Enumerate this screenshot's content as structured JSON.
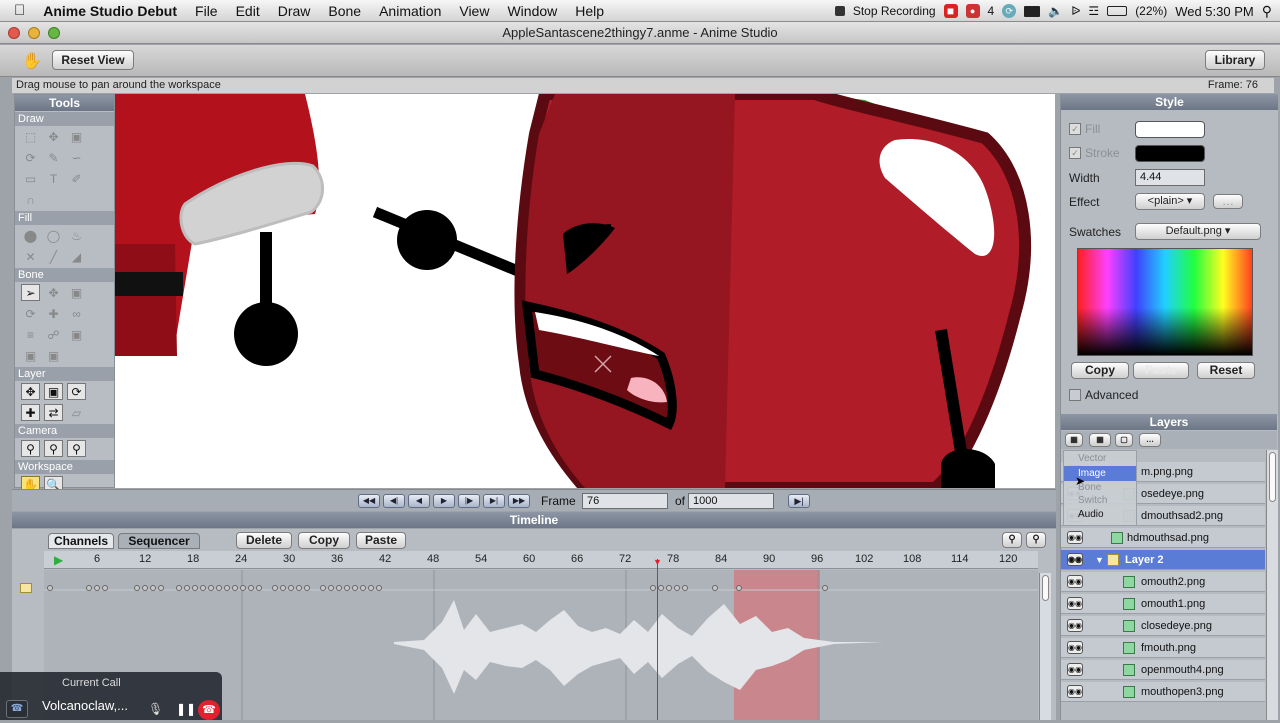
{
  "menubar": {
    "app": "Anime Studio Debut",
    "items": [
      "File",
      "Edit",
      "Draw",
      "Bone",
      "Animation",
      "View",
      "Window",
      "Help"
    ],
    "stop_recording": "Stop Recording",
    "extras_num": "4",
    "battery": "(22%)",
    "clock": "Wed 5:30 PM"
  },
  "window": {
    "title": "AppleSantascene2thingy7.anme - Anime Studio"
  },
  "toolbar": {
    "reset_view": "Reset View",
    "library": "Library"
  },
  "status": {
    "hint": "Drag mouse to pan around the workspace",
    "frame_label": "Frame: 76"
  },
  "tools": {
    "title": "Tools",
    "sections": {
      "draw": "Draw",
      "fill": "Fill",
      "bone": "Bone",
      "layer": "Layer",
      "camera": "Camera",
      "workspace": "Workspace"
    }
  },
  "playback": {
    "frame_label": "Frame",
    "frame_value": "76",
    "of_label": "of",
    "total_frames": "1000"
  },
  "timeline": {
    "title": "Timeline",
    "tabs": [
      "Channels",
      "Sequencer"
    ],
    "delete": "Delete",
    "copy": "Copy",
    "paste": "Paste",
    "ruler": [
      "6",
      "12",
      "18",
      "24",
      "30",
      "36",
      "42",
      "48",
      "54",
      "60",
      "66",
      "72",
      "78",
      "84",
      "90",
      "96",
      "102",
      "108",
      "114",
      "120"
    ],
    "current_frame": 76
  },
  "style": {
    "title": "Style",
    "fill_label": "Fill",
    "stroke_label": "Stroke",
    "fill_color": "#ffffff",
    "stroke_color": "#000000",
    "width_label": "Width",
    "width_value": "4.44",
    "effect_label": "Effect",
    "effect_value": "<plain>",
    "swatches_label": "Swatches",
    "swatches_value": "Default.png",
    "copy": "Copy",
    "paste": "Paste",
    "reset": "Reset",
    "advanced": "Advanced"
  },
  "layers": {
    "title": "Layers",
    "new_layer_menu": [
      "Vector",
      "Image",
      "Bone",
      "Switch",
      "Audio"
    ],
    "items": [
      {
        "name": "m.png.png",
        "indent": 1
      },
      {
        "name": "osedeye.png",
        "indent": 1
      },
      {
        "name": "dmouthsad2.png",
        "indent": 1
      },
      {
        "name": "hdmouthsad.png",
        "indent": 1
      },
      {
        "name": "Layer 2",
        "indent": 0,
        "group": true
      },
      {
        "name": "omouth2.png",
        "indent": 1
      },
      {
        "name": "omouth1.png",
        "indent": 1
      },
      {
        "name": "closedeye.png",
        "indent": 1
      },
      {
        "name": "fmouth.png",
        "indent": 1
      },
      {
        "name": "openmouth4.png",
        "indent": 1
      },
      {
        "name": "mouthopen3.png",
        "indent": 1
      }
    ]
  },
  "call": {
    "title": "Current Call",
    "name": "Volcanoclaw,..."
  }
}
